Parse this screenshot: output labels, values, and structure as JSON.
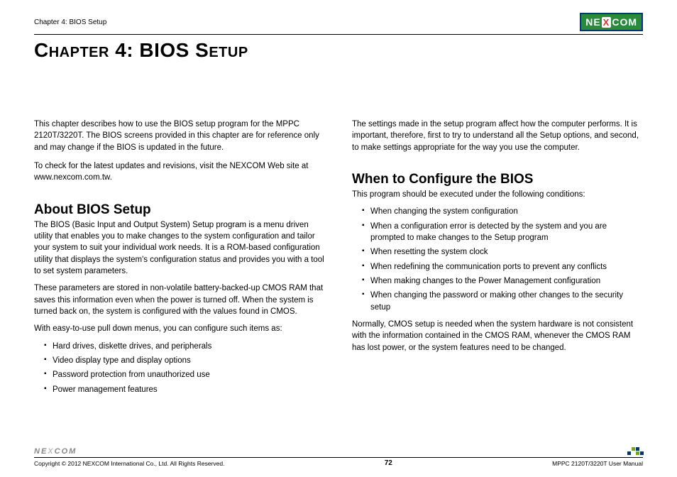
{
  "header": {
    "breadcrumb": "Chapter 4: BIOS Setup",
    "logo_text_left": "NE",
    "logo_text_x": "X",
    "logo_text_right": "COM"
  },
  "title": "Chapter 4: BIOS Setup",
  "left": {
    "intro1": "This chapter describes how to use the BIOS setup program for the MPPC 2120T/3220T. The BIOS screens provided in this chapter are for reference only and may change if the BIOS is updated in the future.",
    "intro2": "To check for the latest updates and revisions, visit the NEXCOM Web site at www.nexcom.com.tw.",
    "about_heading": "About BIOS Setup",
    "about_p1": "The BIOS (Basic Input and Output System) Setup program is a menu driven utility that enables you to make changes to the system configuration and tailor your system to suit your individual work needs. It is a ROM-based configuration utility that displays the system's configuration status and provides you with a tool to set system parameters.",
    "about_p2": "These parameters are stored in non-volatile battery-backed-up CMOS RAM that saves this information even when the power is turned off. When the system is turned back on, the system is configured with the values found in CMOS.",
    "about_p3": "With easy-to-use pull down menus, you can configure such items as:",
    "about_bullets": [
      "Hard drives, diskette drives, and peripherals",
      "Video display type and display options",
      "Password protection from unauthorized use",
      "Power management features"
    ]
  },
  "right": {
    "intro": "The settings made in the setup program affect how the computer performs. It is important, therefore, first to try to understand all the Setup options, and second, to make settings appropriate for the way you use the computer.",
    "when_heading": "When to Configure the BIOS",
    "when_intro": "This program should be executed under the following conditions:",
    "when_bullets": [
      "When changing the system configuration",
      "When a configuration error is detected by the system and you are prompted to make changes to the Setup program",
      "When resetting the system clock",
      "When redefining the communication ports to prevent any conflicts",
      "When making changes to the Power Management configuration",
      "When changing the password or making other changes to the security setup"
    ],
    "when_outro": "Normally, CMOS setup is needed when the system hardware is not consistent with the information contained in the CMOS RAM, whenever the CMOS RAM has lost power, or the system features need to be changed."
  },
  "footer": {
    "logo_text": "NEXCOM",
    "copyright": "Copyright © 2012 NEXCOM International Co., Ltd. All Rights Reserved.",
    "page_number": "72",
    "manual": "MPPC 2120T/3220T User Manual"
  }
}
